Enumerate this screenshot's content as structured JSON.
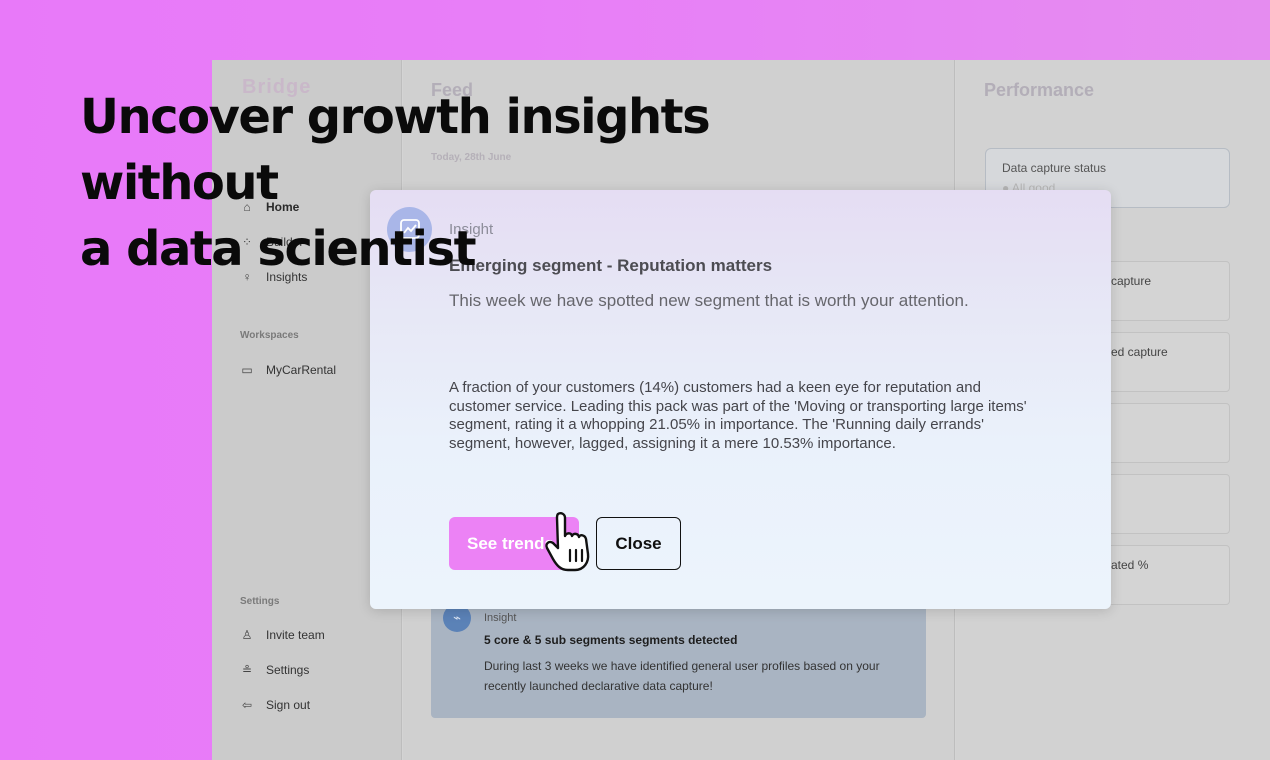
{
  "headline": {
    "line1": "Uncover growth insights without",
    "line2": "a data scientist"
  },
  "sidebar": {
    "brand": "Bridge",
    "main_items": [
      {
        "label": "Home",
        "icon": "home-icon"
      },
      {
        "label": "Builder",
        "icon": "builder-icon"
      },
      {
        "label": "Insights",
        "icon": "lightbulb-icon"
      }
    ],
    "workspaces_label": "Workspaces",
    "workspace_items": [
      {
        "label": "MyCarRental",
        "icon": "folder-icon"
      }
    ],
    "settings_label": "Settings",
    "settings_items": [
      {
        "label": "Invite team",
        "icon": "user-icon"
      },
      {
        "label": "Settings",
        "icon": "sliders-icon"
      },
      {
        "label": "Sign out",
        "icon": "sign-out-icon"
      }
    ]
  },
  "feed": {
    "title": "Feed",
    "date": "Today, 28th June",
    "card": {
      "kicker": "Insight",
      "title": "5 core & 5 sub segments segments detected",
      "body": "During last 3 weeks we have identified general user profiles based on your recently launched declarative data capture!"
    }
  },
  "performance": {
    "title": "Performance",
    "status_label": "Data capture status",
    "status_value": "● All good",
    "cards": [
      {
        "label": "capture"
      },
      {
        "label": "ed capture"
      },
      {
        "label": ""
      },
      {
        "label": ""
      },
      {
        "label": "ated %"
      }
    ]
  },
  "modal": {
    "kicker": "Insight",
    "title": "Emerging segment - Reputation matters",
    "lead": "This week we have spotted new segment that is worth your attention.",
    "body": "A fraction of your customers (14%) customers had a keen eye for reputation and customer service. Leading this pack was part of the 'Moving or transporting large items' segment, rating it a whopping 21.05% in importance. The 'Running daily errands' segment, however, lagged, assigning it a mere 10.53% importance.",
    "primary_button": "See trends",
    "secondary_button": "Close"
  },
  "colors": {
    "background": "#e879f9",
    "primary_button": "#ec82f5",
    "modal_icon": "#a9b6e8",
    "feed_card": "#a9b4c2"
  }
}
